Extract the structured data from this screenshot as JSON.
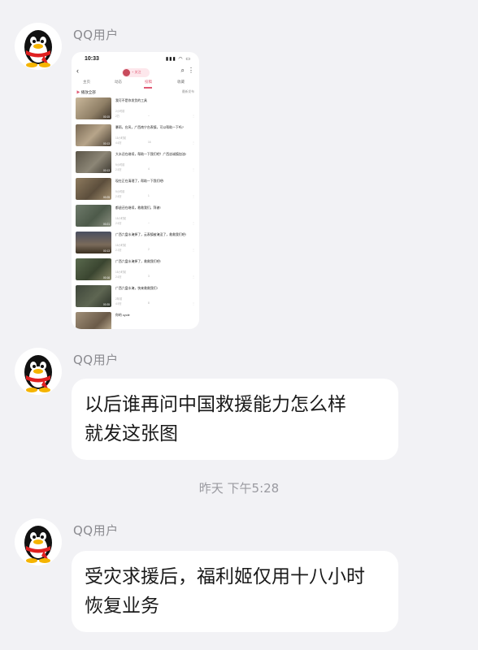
{
  "messages": [
    {
      "sender": "QQ用户",
      "type": "image"
    },
    {
      "sender": "QQ用户",
      "type": "text",
      "lines": [
        "以后谁再问中国救援能力怎么样",
        "就发这张图"
      ]
    },
    {
      "sender": "QQ用户",
      "type": "text",
      "lines": [
        "受灾求援后，福利姬仅用十八小时",
        "恢复业务"
      ]
    }
  ],
  "timestamp": "昨天 下午5:28",
  "screenshot": {
    "status_time": "10:33",
    "status_icons": "▮▮▮ ◠ ▭",
    "header_pill": "+ 关注",
    "tabs": [
      "主页",
      "动态",
      "投稿",
      "收藏"
    ],
    "active_tab": "投稿",
    "play_all": "播放全部",
    "sort": "最新发布",
    "videos": [
      {
        "title": "我可不是你发货的工具",
        "uploaded": "2小时前",
        "plays": "2万",
        "danmaku": "--",
        "duration": "00:15"
      },
      {
        "title": "暴雨，台风，广西南宁台表镇，可以帮助一下吗?",
        "uploaded": "15小时前",
        "plays": "4.6万",
        "danmaku": "16",
        "duration": "00:13"
      },
      {
        "title": "大水还在继续，帮助一下我们吧！广西忠诚镇加油!",
        "uploaded": "9小时前",
        "plays": "2.5万",
        "danmaku": "4",
        "duration": "00:13"
      },
      {
        "title": "现在正在清理了，帮助一下我们吧!",
        "uploaded": "9小时前",
        "plays": "2.8万",
        "danmaku": "1",
        "duration": "00:25"
      },
      {
        "title": "都退还在继续，救救我们，拜谢!",
        "uploaded": "15小时前",
        "plays": "2.5万",
        "danmaku": "--",
        "duration": "00:21"
      },
      {
        "title": "广西六盘水淹掉了，云表镇被淹没了，救救我们吧!",
        "uploaded": "15小时前",
        "plays": "2.3万",
        "danmaku": "2",
        "duration": "00:13"
      },
      {
        "title": "广西六盘水淹掉了，救救我们吧!",
        "uploaded": "15小时前",
        "plays": "2.6万",
        "danmaku": "3",
        "duration": "00:16"
      },
      {
        "title": "广西六盘水淹，快来救救我们!",
        "uploaded": "2年前",
        "plays": "4.9万",
        "danmaku": "8",
        "duration": "00:35"
      },
      {
        "title": "你的 cycle",
        "uploaded": "",
        "plays": "",
        "danmaku": "",
        "duration": ""
      }
    ]
  },
  "colors": {
    "background": "#f2f2f5",
    "bubble": "#ffffff",
    "accent": "#e05a74"
  },
  "icons": [
    "qq-penguin-avatar",
    "back-icon",
    "search-icon",
    "more-icon",
    "play-icon"
  ]
}
